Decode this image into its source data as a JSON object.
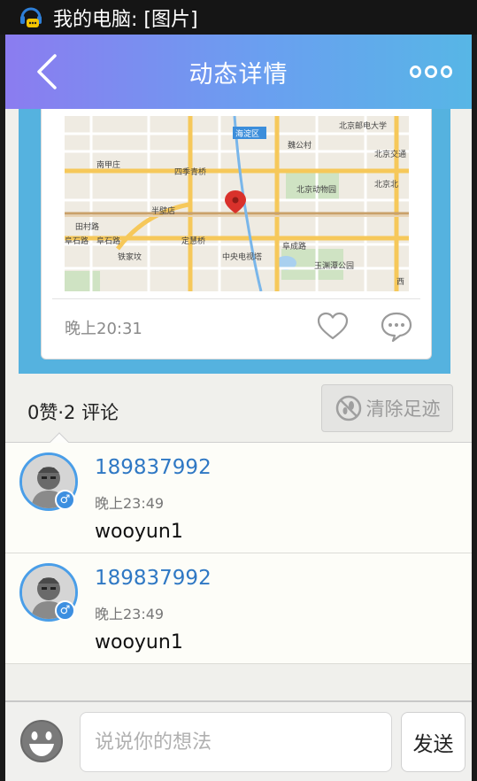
{
  "status_bar": {
    "title": "我的电脑: [图片]",
    "app_icon": "qq-chat-icon"
  },
  "nav": {
    "title": "动态详情",
    "back_icon": "chevron-left-icon",
    "more_icon": "more-dots-icon"
  },
  "post": {
    "time": "晚上20:31",
    "map_labels": [
      "海淀区",
      "北京邮电大学",
      "北京交通",
      "魏公村",
      "南甲庄",
      "四季青桥",
      "北京动物园",
      "北京北",
      "半壁店",
      "田村路",
      "阜石路",
      "阜石路",
      "定慧桥",
      "阜成路",
      "铁家坟",
      "中央电视塔",
      "玉渊潭公园",
      "西"
    ],
    "like_icon": "heart-outline-icon",
    "comment_icon": "speech-bubble-icon"
  },
  "stats": {
    "text": "0赞·2 评论",
    "clear_button": "清除足迹",
    "clear_icon": "no-footprint-icon"
  },
  "comments": [
    {
      "user": "189837992",
      "time": "晚上23:49",
      "text": "wooyun1",
      "gender": "♂"
    },
    {
      "user": "189837992",
      "time": "晚上23:49",
      "text": "wooyun1",
      "gender": "♂"
    }
  ],
  "composer": {
    "placeholder": "说说你的想法",
    "send_label": "发送",
    "emoji_icon": "smiley-icon"
  },
  "colors": {
    "nav_gradient_start": "#8b7cf0",
    "nav_gradient_end": "#57b6e6",
    "post_band": "#55b2df",
    "username": "#2f78c4",
    "avatar_ring": "#4a9ee8"
  }
}
